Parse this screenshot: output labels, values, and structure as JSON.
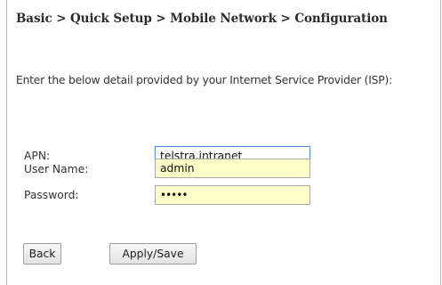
{
  "breadcrumb": "Basic > Quick Setup > Mobile Network > Configuration",
  "intro": "Enter the below detail provided by your Internet Service Provider (ISP):",
  "form": {
    "apn_label": "APN:",
    "apn_value": "telstra.intranet",
    "username_label": "User Name:",
    "username_value": "admin",
    "password_label": "Password:",
    "password_value": "•••••"
  },
  "buttons": {
    "back_label": "Back",
    "apply_label": "Apply/Save"
  },
  "colors": {
    "field_background": "#ffffc8",
    "focused_border": "#5b8fd4"
  }
}
